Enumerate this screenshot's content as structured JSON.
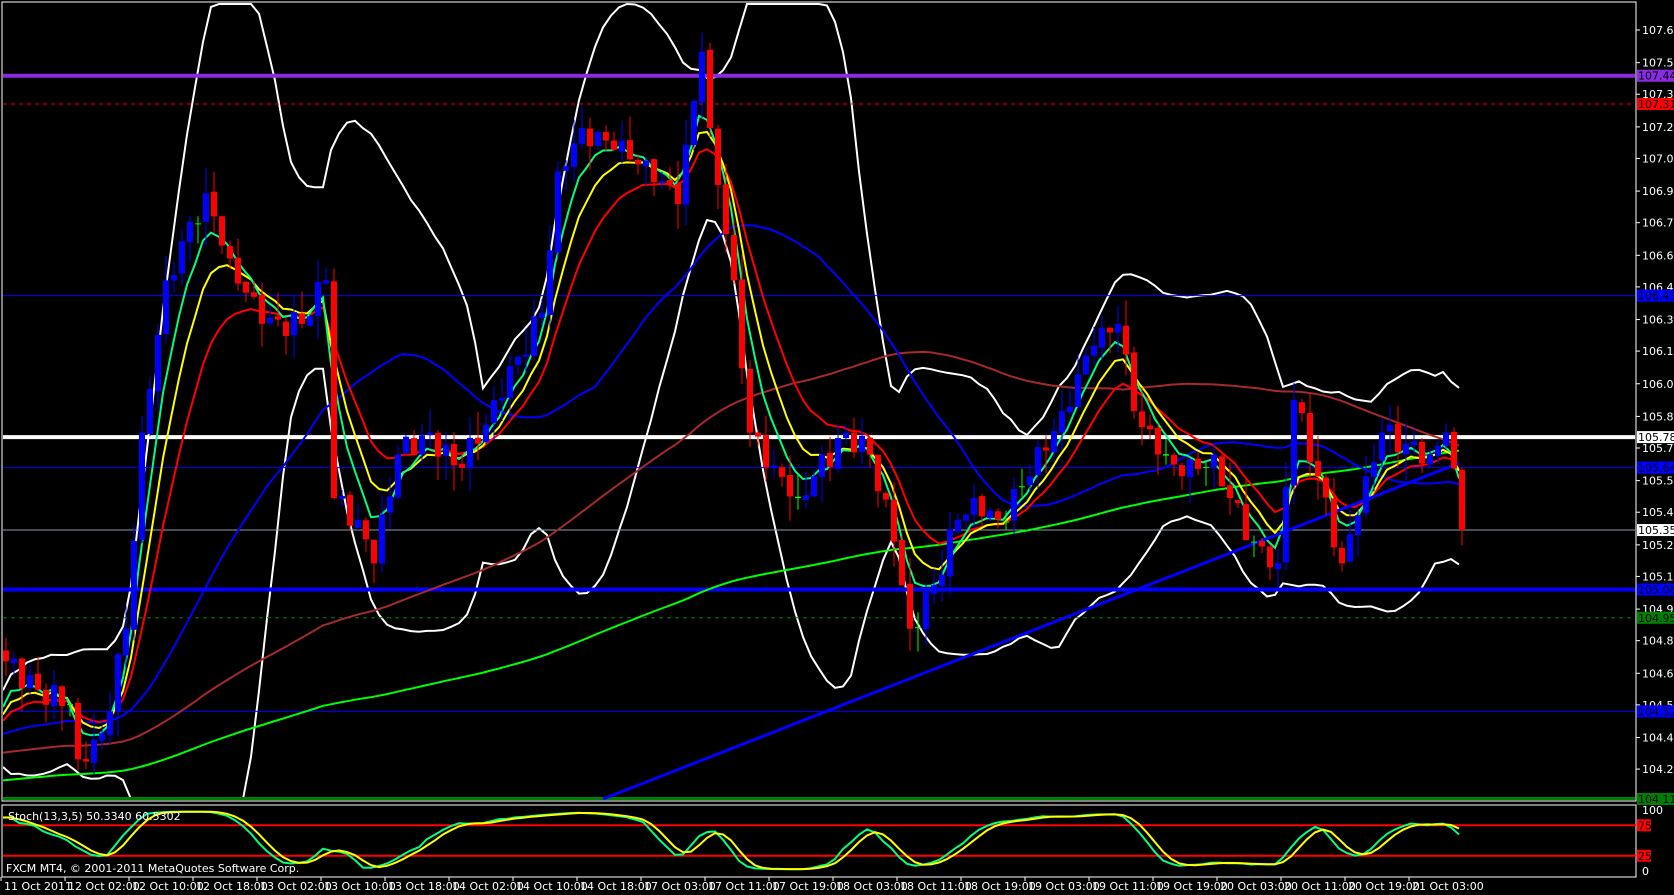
{
  "chart_data": {
    "type": "candlestick",
    "symbol_note": "FXCM MT4, © 2001-2011 MetaQuotes Software Corp.",
    "indicator_label": "Stoch(13,3,5) 50.3340 60.5302",
    "price_range": [
      104.11,
      107.7
    ],
    "price_ticks": [
      "107.650",
      "107.500",
      "107.355",
      "107.205",
      "107.060",
      "106.910",
      "106.765",
      "106.615",
      "106.470",
      "106.320",
      "106.175",
      "106.025",
      "105.875",
      "105.730",
      "105.580",
      "105.435",
      "105.285",
      "105.140",
      "104.990",
      "104.845",
      "104.695",
      "104.550",
      "104.400",
      "104.255"
    ],
    "time_labels": [
      "11 Oct 2011",
      "12 Oct 02:00",
      "12 Oct 10:00",
      "12 Oct 18:00",
      "13 Oct 02:00",
      "13 Oct 10:00",
      "13 Oct 18:00",
      "14 Oct 02:00",
      "14 Oct 10:00",
      "14 Oct 18:00",
      "17 Oct 03:00",
      "17 Oct 11:00",
      "17 Oct 19:00",
      "18 Oct 03:00",
      "18 Oct 11:00",
      "18 Oct 19:00",
      "19 Oct 03:00",
      "19 Oct 11:00",
      "19 Oct 19:00",
      "20 Oct 03:00",
      "20 Oct 11:00",
      "20 Oct 19:00",
      "21 Oct 03:00"
    ],
    "candle_count": 183,
    "close_keyframes": [
      [
        0,
        104.75
      ],
      [
        4,
        104.62
      ],
      [
        8,
        104.55
      ],
      [
        9,
        104.3
      ],
      [
        12,
        104.42
      ],
      [
        15,
        104.9
      ],
      [
        17,
        105.8
      ],
      [
        20,
        106.5
      ],
      [
        25,
        106.9
      ],
      [
        28,
        106.6
      ],
      [
        32,
        106.3
      ],
      [
        37,
        106.3
      ],
      [
        40,
        106.5
      ],
      [
        41,
        105.5
      ],
      [
        44,
        105.4
      ],
      [
        46,
        105.2
      ],
      [
        49,
        105.7
      ],
      [
        53,
        105.8
      ],
      [
        56,
        105.65
      ],
      [
        59,
        105.75
      ],
      [
        61,
        105.95
      ],
      [
        64,
        106.15
      ],
      [
        67,
        106.35
      ],
      [
        69,
        107.0
      ],
      [
        72,
        107.2
      ],
      [
        76,
        107.1
      ],
      [
        80,
        107.05
      ],
      [
        84,
        106.85
      ],
      [
        87,
        107.55
      ],
      [
        88,
        107.2
      ],
      [
        91,
        106.5
      ],
      [
        93,
        105.8
      ],
      [
        96,
        105.65
      ],
      [
        99,
        105.5
      ],
      [
        101,
        105.6
      ],
      [
        105,
        105.8
      ],
      [
        108,
        105.7
      ],
      [
        111,
        105.3
      ],
      [
        113,
        104.9
      ],
      [
        116,
        105.1
      ],
      [
        119,
        105.4
      ],
      [
        121,
        105.5
      ],
      [
        124,
        105.4
      ],
      [
        128,
        105.6
      ],
      [
        132,
        105.9
      ],
      [
        136,
        106.2
      ],
      [
        139,
        106.3
      ],
      [
        141,
        105.9
      ],
      [
        144,
        105.7
      ],
      [
        147,
        105.6
      ],
      [
        151,
        105.7
      ],
      [
        153,
        105.5
      ],
      [
        156,
        105.3
      ],
      [
        159,
        105.2
      ],
      [
        161,
        105.95
      ],
      [
        164,
        105.6
      ],
      [
        167,
        105.2
      ],
      [
        170,
        105.6
      ],
      [
        172,
        105.8
      ],
      [
        175,
        105.75
      ],
      [
        178,
        105.7
      ],
      [
        180,
        105.8
      ],
      [
        182,
        105.353
      ]
    ],
    "levels": [
      {
        "price": 107.44,
        "label": "107.440",
        "color": "#8a2be2",
        "style": "thick"
      },
      {
        "price": 107.31,
        "label": "107.310",
        "color": "#ff0000",
        "style": "dashed"
      },
      {
        "price": 106.43,
        "label": "106.430",
        "color": "#0000ff",
        "style": "thin"
      },
      {
        "price": 105.78,
        "label": "105.780",
        "color": "#ffffff",
        "style": "thick"
      },
      {
        "price": 105.64,
        "label": "105.640",
        "color": "#0000ff",
        "style": "thin"
      },
      {
        "price": 105.353,
        "label": "105.353",
        "color": "#8c9aa8",
        "style": "bid"
      },
      {
        "price": 105.08,
        "label": "105.080",
        "color": "#0000ff",
        "style": "thick"
      },
      {
        "price": 104.95,
        "label": "104.950",
        "color": "#008000",
        "style": "dashed"
      },
      {
        "price": 104.52,
        "label": "104.520",
        "color": "#0000ff",
        "style": "thin"
      },
      {
        "price": 104.11,
        "label": "104.110",
        "color": "#008000",
        "style": "thick"
      }
    ],
    "trendline": {
      "from": [
        75,
        104.11
      ],
      "to": [
        182,
        105.66
      ],
      "color": "#0000ff"
    },
    "moving_averages": [
      {
        "name": "EMA5",
        "period": 5,
        "type": "ema",
        "color": "#00ff7f"
      },
      {
        "name": "EMA8",
        "period": 8,
        "type": "ema",
        "color": "#ffff00"
      },
      {
        "name": "EMA13",
        "period": 13,
        "type": "ema",
        "color": "#ff0000"
      },
      {
        "name": "SMA34",
        "period": 34,
        "type": "sma",
        "color": "#0000ff"
      },
      {
        "name": "SMA100",
        "period": 100,
        "type": "sma",
        "color": "#a52a2a"
      },
      {
        "name": "SMA200",
        "period": 200,
        "type": "sma",
        "color": "#00ff00"
      }
    ],
    "bollinger": {
      "period": 20,
      "deviation": 2.2,
      "color": "#ffffff"
    },
    "stochastic": {
      "k": 13,
      "d": 3,
      "slowing": 5,
      "main": 50.334,
      "signal": 60.5302,
      "levels": [
        "75",
        "25"
      ],
      "axis": [
        "100",
        "0"
      ],
      "main_color": "#00ff7f",
      "signal_color": "#ffff00"
    },
    "colors": {
      "bull": "#0000ff",
      "bear": "#ff0000",
      "doji": "#00ff00",
      "background": "#000000",
      "axis": "#ffffff"
    }
  }
}
